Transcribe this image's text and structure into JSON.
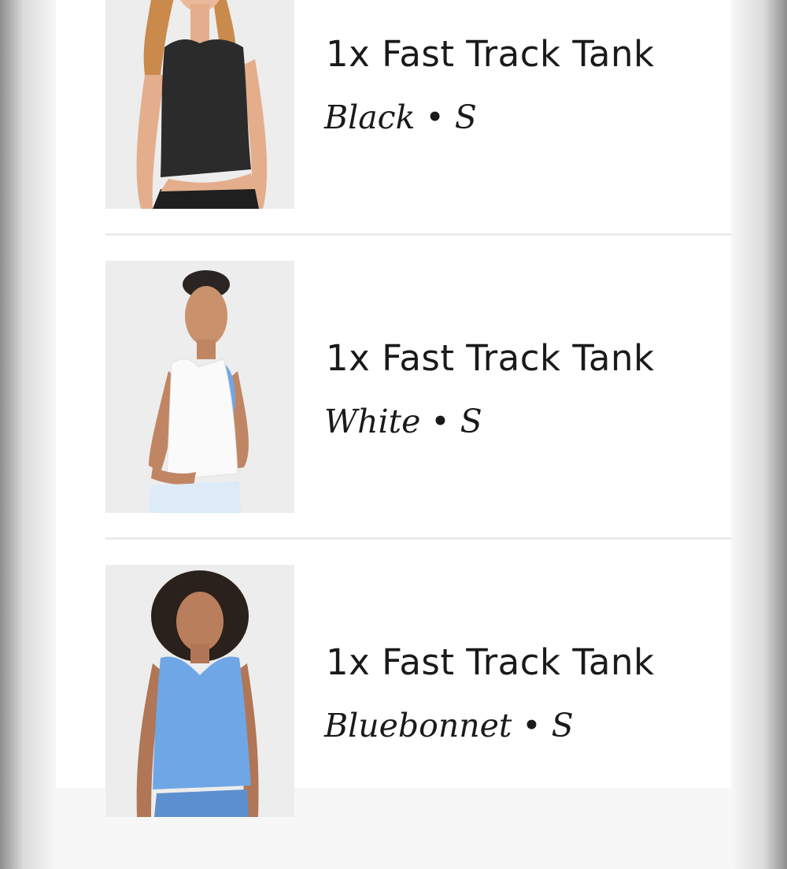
{
  "cart": {
    "items": [
      {
        "title": "1x Fast Track Tank",
        "color": "Black",
        "size": "S",
        "variant": "Black • S",
        "image": "model-wearing-black-tank"
      },
      {
        "title": "1x Fast Track Tank",
        "color": "White",
        "size": "S",
        "variant": "White • S",
        "image": "model-wearing-white-tank"
      },
      {
        "title": "1x Fast Track Tank",
        "color": "Bluebonnet",
        "size": "S",
        "variant": "Bluebonnet • S",
        "image": "model-wearing-bluebonnet-tank"
      }
    ]
  },
  "colors": {
    "page_bg": "#ffffff",
    "thumb_bg": "#ececec",
    "text": "#1a1a1a",
    "divider": "#ebebeb",
    "tank_black": "#2b2b2b",
    "tank_white": "#fafafa",
    "tank_bluebonnet": "#6fa6e6"
  }
}
